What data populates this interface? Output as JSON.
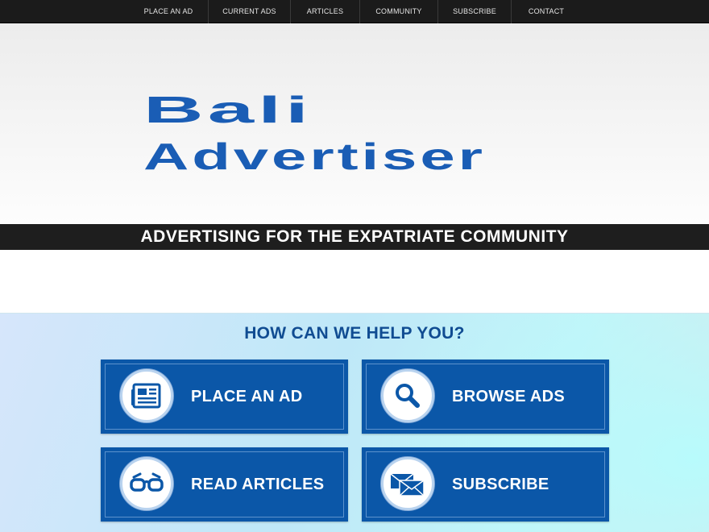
{
  "nav": {
    "items": [
      {
        "label": "PLACE AN AD"
      },
      {
        "label": "CURRENT ADS"
      },
      {
        "label": "ARTICLES"
      },
      {
        "label": "COMMUNITY"
      },
      {
        "label": "SUBSCRIBE"
      },
      {
        "label": "CONTACT"
      }
    ]
  },
  "logo": {
    "line1": "Bali",
    "line2": "Advertiser",
    "color": "#1a5db5"
  },
  "tagline": "ADVERTISING FOR THE EXPATRIATE COMMUNITY",
  "help": {
    "title": "HOW CAN WE HELP YOU?",
    "tiles": [
      {
        "label": "PLACE AN AD",
        "icon": "newspaper-icon"
      },
      {
        "label": "BROWSE ADS",
        "icon": "magnifier-icon"
      },
      {
        "label": "READ ARTICLES",
        "icon": "glasses-icon"
      },
      {
        "label": "SUBSCRIBE",
        "icon": "envelope-icon"
      }
    ]
  },
  "colors": {
    "nav_bg": "#1b1b1b",
    "tile_bg": "#0b57a8",
    "title": "#104c92"
  }
}
